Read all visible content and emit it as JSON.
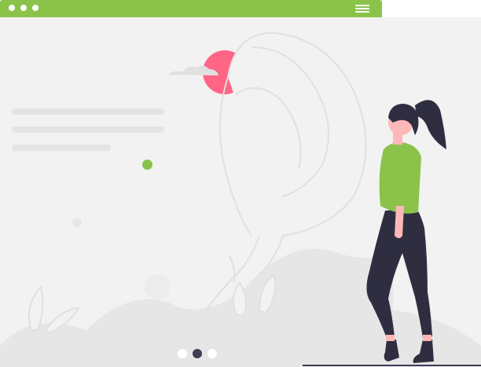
{
  "window": {
    "titlebar_color": "#8bc34a",
    "window_controls": [
      "dot-icon",
      "dot-icon",
      "dot-icon"
    ],
    "menu_icon": "hamburger-menu-icon"
  },
  "hero": {
    "placeholder_lines": 3,
    "accent_dot_color": "#8bc34a",
    "sun_color": "#ff6584"
  },
  "carousel": {
    "dot_count": 3,
    "active_index": 1
  },
  "colors": {
    "background": "#f2f2f2",
    "shape": "#e6e6e6",
    "figure_dark": "#2f2e41",
    "figure_shirt": "#8bc34a",
    "skin": "#ffb8b8"
  }
}
